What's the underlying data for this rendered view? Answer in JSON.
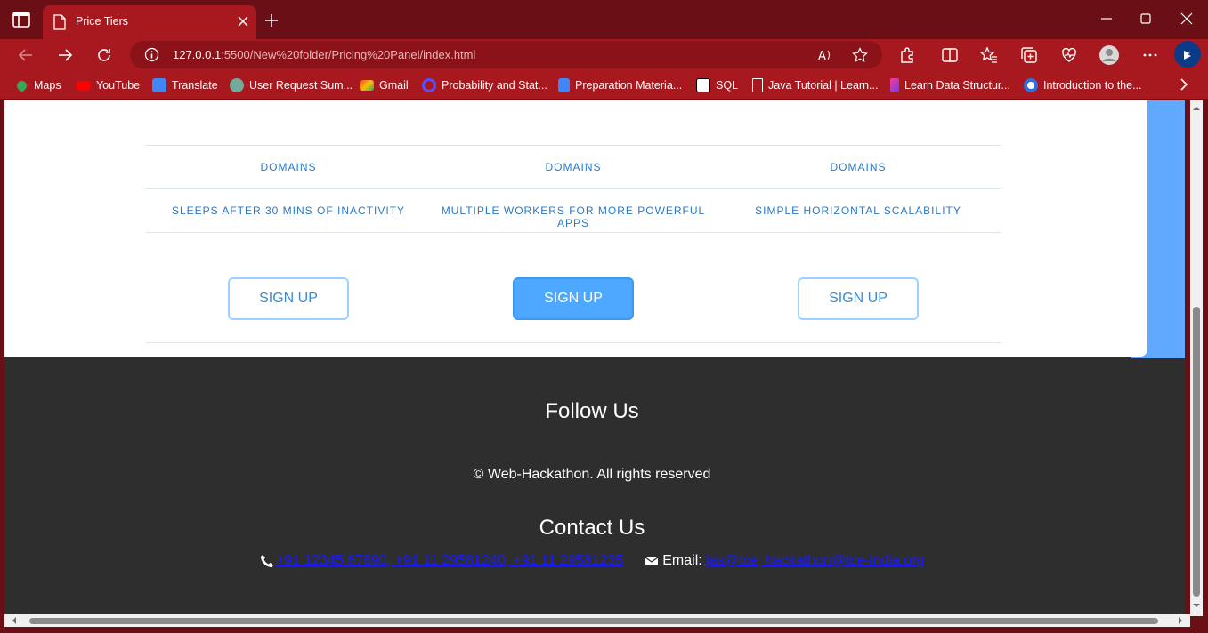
{
  "browser": {
    "tab_title": "Price Tiers",
    "url_host": "127.0.0.1",
    "url_rest": ":5500/New%20folder/Pricing%20Panel/index.html"
  },
  "bookmarks": [
    {
      "label": "Maps",
      "icon": "maps-icon",
      "color": "#34a853"
    },
    {
      "label": "YouTube",
      "icon": "youtube-icon",
      "color": "#ff0000"
    },
    {
      "label": "Translate",
      "icon": "translate-icon",
      "color": "#4285f4"
    },
    {
      "label": "User Request Sum...",
      "icon": "chatgpt-icon",
      "color": "#74aa9c"
    },
    {
      "label": "Gmail",
      "icon": "gmail-icon",
      "color": "#ea4335"
    },
    {
      "label": "Probability and Stat...",
      "icon": "q-icon",
      "color": "#5a4fff"
    },
    {
      "label": "Preparation Materia...",
      "icon": "docs-icon",
      "color": "#4285f4"
    },
    {
      "label": "SQL",
      "icon": "notion-icon",
      "color": "#ffffff"
    },
    {
      "label": "Java Tutorial | Learn...",
      "icon": "page-icon",
      "color": "#ffffff"
    },
    {
      "label": "Learn Data Structur...",
      "icon": "ds-icon",
      "color": "#6a3df0"
    },
    {
      "label": "Introduction to the...",
      "icon": "c-icon",
      "color": "#2f6fe0"
    }
  ],
  "pricing": {
    "domains_row": [
      "DOMAINS",
      "DOMAINS",
      "DOMAINS"
    ],
    "features_row": [
      "SLEEPS AFTER 30 MINS OF INACTIVITY",
      "MULTIPLE WORKERS FOR MORE POWERFUL APPS",
      "SIMPLE HORIZONTAL SCALABILITY"
    ],
    "signup_labels": [
      "SIGN UP",
      "SIGN UP",
      "SIGN UP"
    ]
  },
  "footer": {
    "follow_title": "Follow Us",
    "copyright": "© Web-Hackathon. All rights reserved",
    "contact_title": "Contact Us",
    "phones": "+91 12345 67890, +91 11 29581240, +91 11 29581235",
    "email_label": "Email: ",
    "emails": "jas@tce, hackathon@tce-india.org"
  }
}
